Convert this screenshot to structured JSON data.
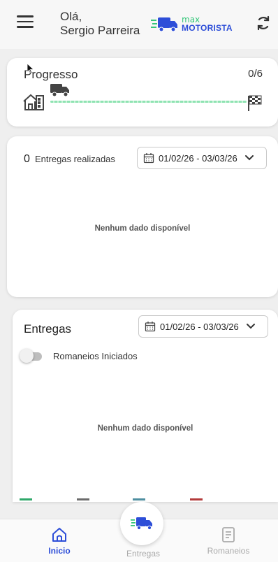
{
  "header": {
    "greeting_line1": "Olá,",
    "greeting_line2": "Sergio Parreira",
    "logo_small": "max",
    "logo_big": "MOTORISTA"
  },
  "progress": {
    "title": "Progresso",
    "count": "0/6",
    "fraction": 0
  },
  "deliveries_done": {
    "count": "0",
    "label": "Entregas realizadas",
    "date_range": "01/02/26 - 03/03/26",
    "empty": "Nenhum dado disponível"
  },
  "entregas": {
    "title": "Entregas",
    "date_range": "01/02/26 - 03/03/26",
    "toggle_label": "Romaneios Iniciados",
    "toggle_on": false,
    "empty": "Nenhum dado disponível"
  },
  "nav": {
    "home": "Inicio",
    "entregas": "Entregas",
    "romaneios": "Romaneios"
  },
  "colors": {
    "brand_blue": "#2d4ed8",
    "brand_green": "#35c67a"
  }
}
